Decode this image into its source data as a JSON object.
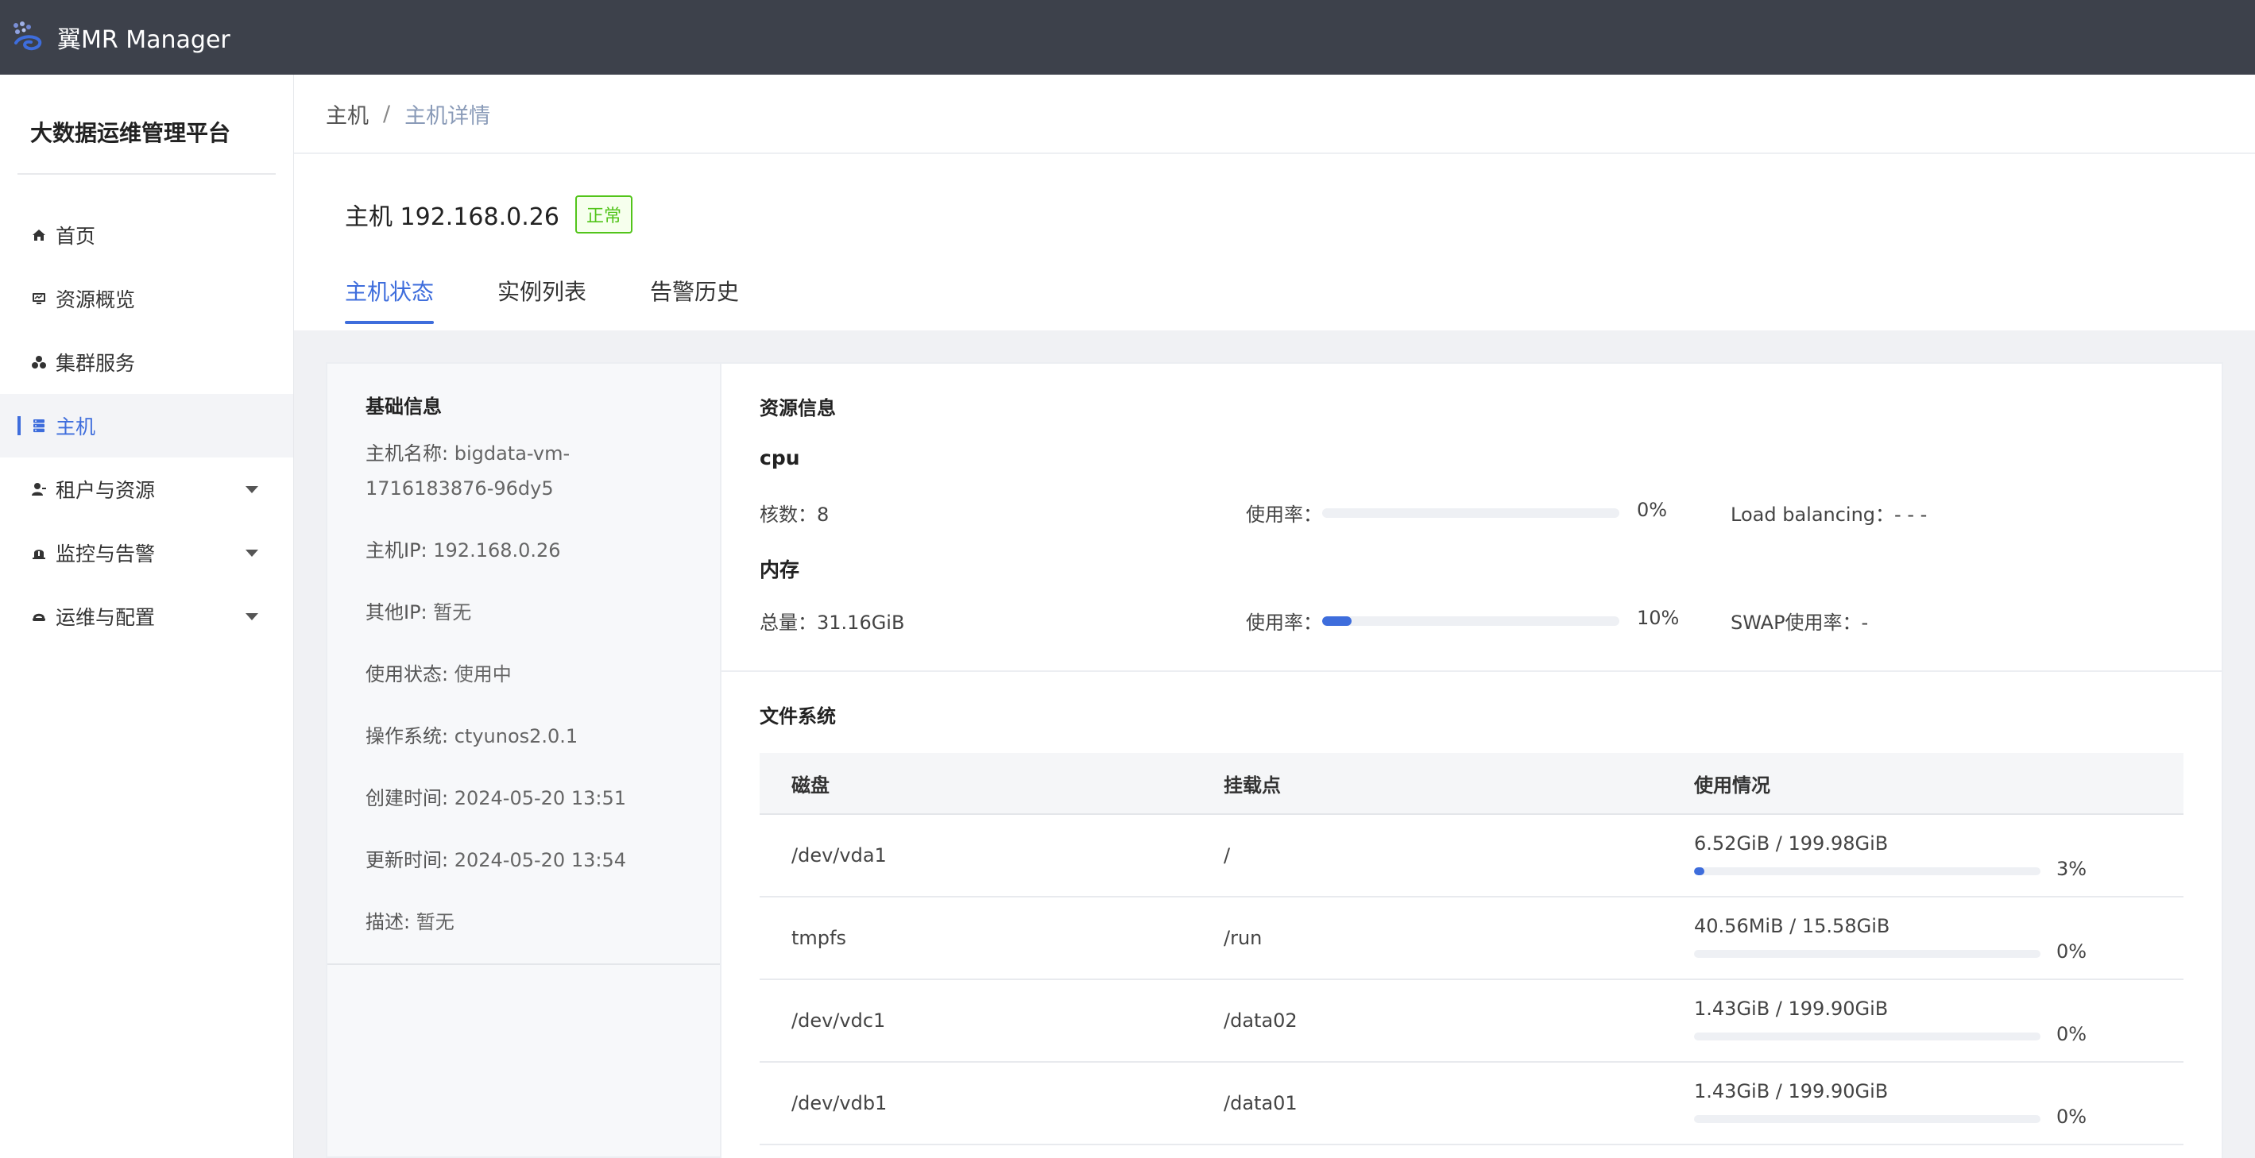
{
  "app": {
    "title": "翼MR Manager",
    "accent_color": "#3e6ddc",
    "logo_icon": "dots-swirl-logo"
  },
  "sidebar": {
    "platform_title": "大数据运维管理平台",
    "items": [
      {
        "label": "首页",
        "icon": "home-icon",
        "expandable": false,
        "active": false
      },
      {
        "label": "资源概览",
        "icon": "monitor-icon",
        "expandable": false,
        "active": false
      },
      {
        "label": "集群服务",
        "icon": "cluster-icon",
        "expandable": false,
        "active": false
      },
      {
        "label": "主机",
        "icon": "server-icon",
        "expandable": false,
        "active": true
      },
      {
        "label": "租户与资源",
        "icon": "user-icon",
        "expandable": true,
        "active": false
      },
      {
        "label": "监控与告警",
        "icon": "alarm-icon",
        "expandable": true,
        "active": false
      },
      {
        "label": "运维与配置",
        "icon": "tools-icon",
        "expandable": true,
        "active": false
      }
    ]
  },
  "breadcrumb": {
    "home": "主机",
    "separator": "/",
    "current": "主机详情"
  },
  "host": {
    "title": "主机 192.168.0.26",
    "status": "正常",
    "status_color": "#52c41a"
  },
  "tabs": [
    {
      "label": "主机状态",
      "active": true
    },
    {
      "label": "实例列表",
      "active": false
    },
    {
      "label": "告警历史",
      "active": false
    }
  ],
  "basic_info": {
    "title": "基础信息",
    "fields": [
      {
        "key": "主机名称: ",
        "value": "bigdata-vm-1716183876-96dy5"
      },
      {
        "key": "主机IP: ",
        "value": "192.168.0.26"
      },
      {
        "key": "其他IP: ",
        "value": "暂无"
      },
      {
        "key": "使用状态: ",
        "value": "使用中"
      },
      {
        "key": "操作系统: ",
        "value": "ctyunos2.0.1"
      },
      {
        "key": "创建时间: ",
        "value": "2024-05-20 13:51"
      },
      {
        "key": "更新时间: ",
        "value": "2024-05-20 13:54"
      },
      {
        "key": "描述: ",
        "value": "暂无"
      }
    ]
  },
  "resource_info": {
    "title": "资源信息",
    "cpu": {
      "title": "cpu",
      "cores_label": "核数：",
      "cores_value": "8",
      "usage_label": "使用率：",
      "usage_percent": 0,
      "usage_text": "0%",
      "load_label": "Load balancing：",
      "load_value": "- - -"
    },
    "memory": {
      "title": "内存",
      "total_label": "总量：",
      "total_value": "31.16GiB",
      "usage_label": "使用率：",
      "usage_percent": 10,
      "usage_text": "10%",
      "swap_label": "SWAP使用率：",
      "swap_value": "-"
    }
  },
  "filesystem": {
    "title": "文件系统",
    "columns": [
      "磁盘",
      "挂载点",
      "使用情况"
    ],
    "rows": [
      {
        "disk": "/dev/vda1",
        "mount": "/",
        "usage": "6.52GiB / 199.98GiB",
        "percent": 3,
        "percent_text": "3%"
      },
      {
        "disk": "tmpfs",
        "mount": "/run",
        "usage": "40.56MiB / 15.58GiB",
        "percent": 0,
        "percent_text": "0%"
      },
      {
        "disk": "/dev/vdc1",
        "mount": "/data02",
        "usage": "1.43GiB / 199.90GiB",
        "percent": 0,
        "percent_text": "0%"
      },
      {
        "disk": "/dev/vdb1",
        "mount": "/data01",
        "usage": "1.43GiB / 199.90GiB",
        "percent": 0,
        "percent_text": "0%"
      }
    ]
  }
}
